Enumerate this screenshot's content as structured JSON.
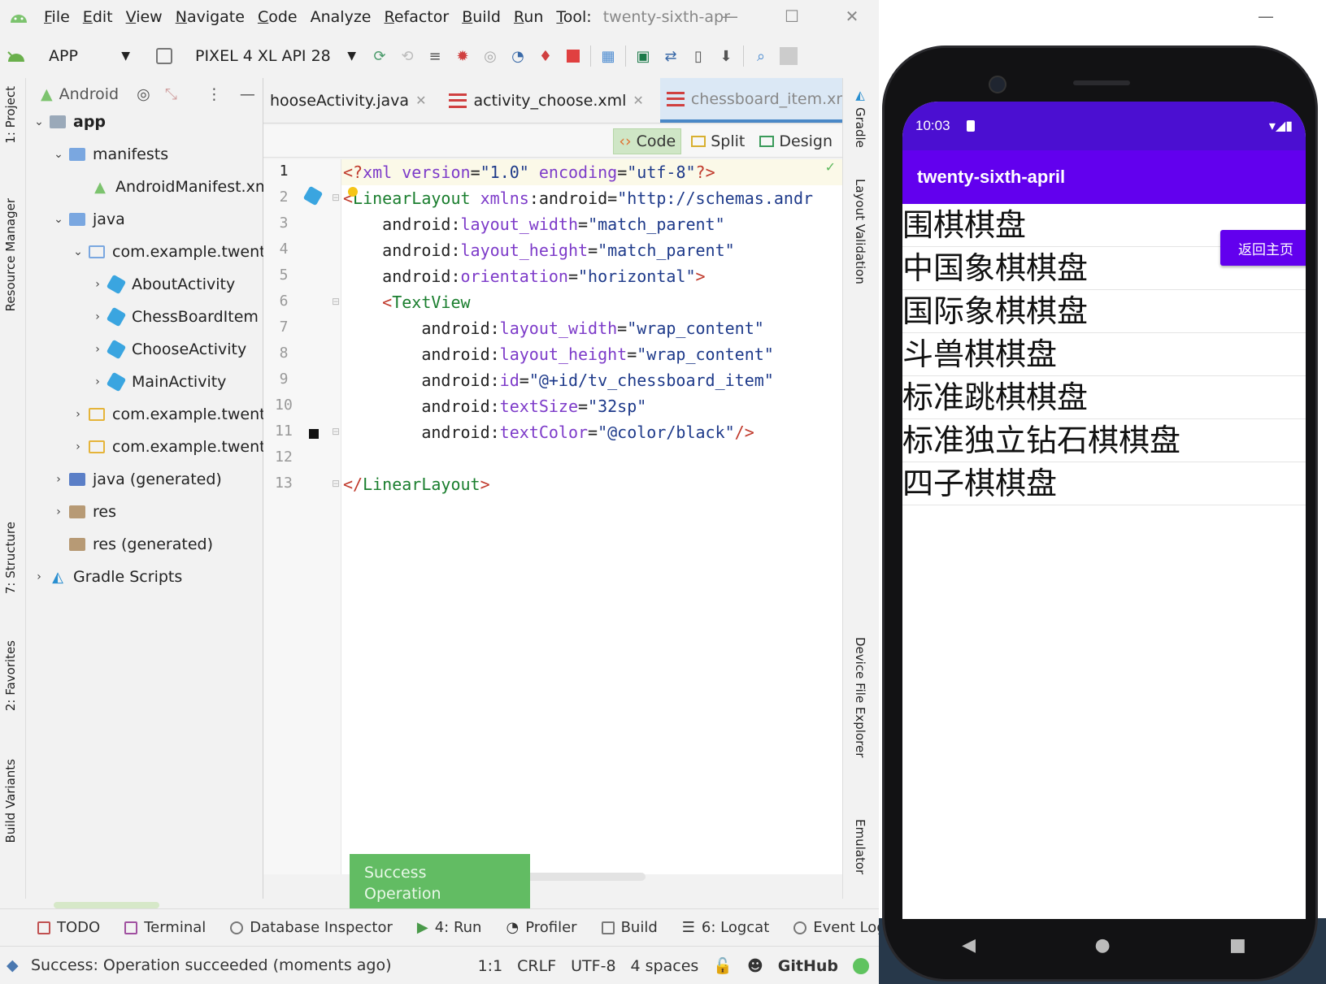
{
  "ide": {
    "menu": [
      {
        "label": "File",
        "u": "F",
        "rest": "ile"
      },
      {
        "label": "Edit",
        "u": "E",
        "rest": "dit"
      },
      {
        "label": "View",
        "u": "V",
        "rest": "iew"
      },
      {
        "label": "Navigate",
        "u": "N",
        "rest": "avigate"
      },
      {
        "label": "Code",
        "u": "C",
        "rest": "ode"
      },
      {
        "label": "Analyze",
        "u": "",
        "rest": "Analyze"
      },
      {
        "label": "Refactor",
        "u": "R",
        "rest": "efactor"
      },
      {
        "label": "Build",
        "u": "B",
        "rest": "uild"
      },
      {
        "label": "Run",
        "u": "R",
        "rest": "un"
      },
      {
        "label": "Tools",
        "u": "T",
        "rest": "ool:"
      }
    ],
    "window_title": "twenty-sixth-apr",
    "toolbar": {
      "run_config": "APP",
      "device": "PIXEL 4 XL API 28"
    },
    "left_tabs": {
      "project": "1: Project",
      "resource_manager": "Resource Manager",
      "structure": "7: Structure",
      "favorites": "2: Favorites",
      "build_variants": "Build Variants"
    },
    "project_panel": {
      "view_mode": "Android",
      "tree": [
        {
          "label": "app",
          "bold": true
        },
        {
          "label": "manifests"
        },
        {
          "label": "AndroidManifest.xml"
        },
        {
          "label": "java"
        },
        {
          "label": "com.example.twenty_"
        },
        {
          "label": "AboutActivity"
        },
        {
          "label": "ChessBoardItem"
        },
        {
          "label": "ChooseActivity"
        },
        {
          "label": "MainActivity"
        },
        {
          "label": "com.example.twenty_"
        },
        {
          "label": "com.example.twenty_"
        },
        {
          "label": "java (generated)"
        },
        {
          "label": "res"
        },
        {
          "label": "res (generated)"
        },
        {
          "label": "Gradle Scripts"
        }
      ]
    },
    "editor_tabs": [
      {
        "label": "hooseActivity.java",
        "active": false
      },
      {
        "label": "activity_choose.xml",
        "active": false
      },
      {
        "label": "chessboard_item.xml",
        "active": true
      }
    ],
    "view_switch": {
      "code": "Code",
      "split": "Split",
      "design": "Design"
    },
    "line_numbers": [
      "1",
      "2",
      "3",
      "4",
      "5",
      "6",
      "7",
      "8",
      "9",
      "10",
      "11",
      "12",
      "13"
    ],
    "code": {
      "l1": {
        "open": "<?",
        "name": "xml",
        "a1": "version",
        "v1": "\"1.0\"",
        "a2": "encoding",
        "v2": "\"utf-8\"",
        "close": "?>"
      },
      "l2": {
        "open": "<",
        "name": "LinearLayout",
        "ns": "xmlns",
        "attr": "android",
        "val": "\"http://schemas.andr"
      },
      "l3": {
        "ns": "android",
        "attr": "layout_width",
        "val": "\"match_parent\""
      },
      "l4": {
        "ns": "android",
        "attr": "layout_height",
        "val": "\"match_parent\""
      },
      "l5": {
        "ns": "android",
        "attr": "orientation",
        "val": "\"horizontal\"",
        "close": ">"
      },
      "l6": {
        "open": "<",
        "name": "TextView"
      },
      "l7": {
        "ns": "android",
        "attr": "layout_width",
        "val": "\"wrap_content\""
      },
      "l8": {
        "ns": "android",
        "attr": "layout_height",
        "val": "\"wrap_content\""
      },
      "l9": {
        "ns": "android",
        "attr": "id",
        "val": "\"@+id/tv_chessboard_item\""
      },
      "l10": {
        "ns": "android",
        "attr": "textSize",
        "val": "\"32sp\""
      },
      "l11": {
        "ns": "android",
        "attr": "textColor",
        "val": "\"@color/black\"",
        "close": "/>"
      },
      "l13": {
        "open": "</",
        "name": "LinearLayout",
        "close": ">"
      }
    },
    "right_tabs": {
      "gradle": "Gradle",
      "layout_validation": "Layout Validation",
      "device_file_explorer": "Device File Explorer",
      "emulator": "Emulator"
    },
    "toast": {
      "title": "Success",
      "message": "Operation succeeded"
    },
    "bottom_tools": [
      {
        "label": "TODO"
      },
      {
        "label": "Terminal"
      },
      {
        "label": "Database Inspector"
      },
      {
        "label": "4: Run"
      },
      {
        "label": "Profiler"
      },
      {
        "label": "Build"
      },
      {
        "label": "6: Logcat"
      },
      {
        "label": "Event Log"
      }
    ],
    "status": {
      "message": "Success: Operation succeeded (moments ago)",
      "position": "1:1",
      "line_sep": "CRLF",
      "encoding": "UTF-8",
      "indent": "4 spaces",
      "vcs": "GitHub"
    }
  },
  "phone": {
    "time": "10:03",
    "app_title": "twenty-sixth-april",
    "back_button": "返回主页",
    "items": [
      "围棋棋盘",
      "中国象棋棋盘",
      "国际象棋棋盘",
      "斗兽棋棋盘",
      "标准跳棋棋盘",
      "标准独立钻石棋棋盘",
      "四子棋棋盘"
    ],
    "colors": {
      "primary": "#6200ee",
      "primary_dark": "#4b0fd1"
    }
  }
}
